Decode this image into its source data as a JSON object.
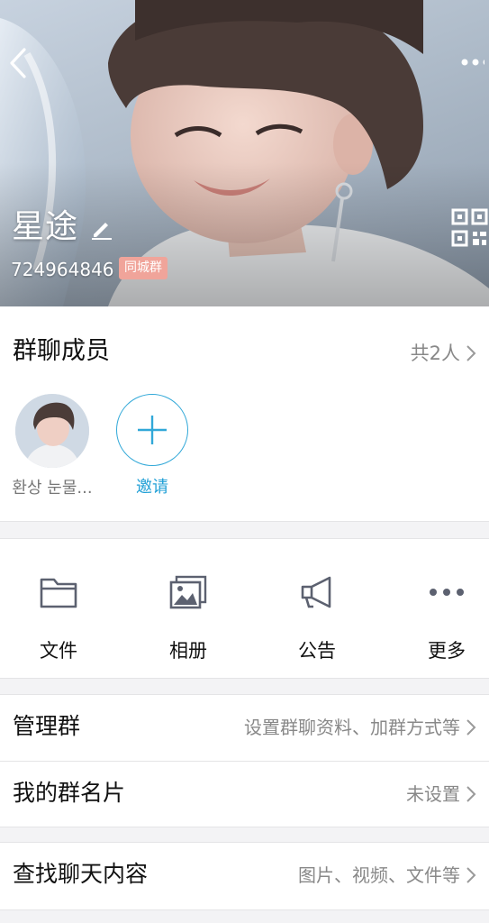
{
  "header": {
    "group_name": "星途",
    "group_id": "724964846",
    "badge": "同城群"
  },
  "icons": {
    "back": "back-arrow-icon",
    "more": "more-dots-icon",
    "edit": "pencil-edit-icon",
    "qr": "qr-code-icon"
  },
  "members": {
    "title": "群聊成员",
    "count_label": "共2人",
    "items": [
      {
        "name": "환상 눈물...",
        "kind": "avatar"
      }
    ],
    "invite_label": "邀请"
  },
  "actions": [
    {
      "label": "文件",
      "icon": "folder-icon"
    },
    {
      "label": "相册",
      "icon": "photo-album-icon"
    },
    {
      "label": "公告",
      "icon": "megaphone-icon"
    },
    {
      "label": "更多",
      "icon": "more-horizontal-icon"
    }
  ],
  "settings": {
    "manage": {
      "label": "管理群",
      "value": "设置群聊资料、加群方式等"
    },
    "card": {
      "label": "我的群名片",
      "value": "未设置"
    },
    "search": {
      "label": "查找聊天内容",
      "value": "图片、视频、文件等"
    }
  },
  "colors": {
    "accent": "#1f9fd6",
    "badge_bg": "#f0a49a",
    "icon_gray": "#5c6170"
  }
}
